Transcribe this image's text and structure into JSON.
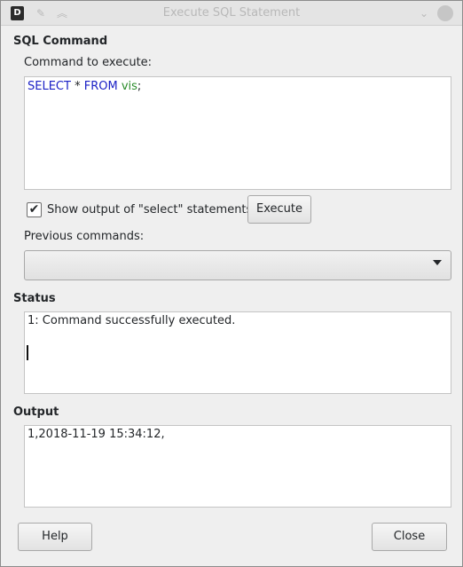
{
  "window": {
    "title": "Execute SQL Statement",
    "app_icon": "D"
  },
  "sql_command": {
    "section_title": "SQL Command",
    "command_label": "Command to execute:",
    "sql": {
      "kw1": "SELECT",
      "op": " * ",
      "kw2": "FROM",
      "space": " ",
      "table": "vis",
      "end": ";"
    },
    "show_output_label": "Show output of \"select\" statements",
    "show_output_checked": "✔",
    "execute_label": "Execute",
    "previous_label": "Previous commands:",
    "previous_value": ""
  },
  "status": {
    "section_title": "Status",
    "text": "1: Command successfully executed."
  },
  "output": {
    "section_title": "Output",
    "text": "1,2018-11-19 15:34:12,"
  },
  "footer": {
    "help_label": "Help",
    "close_label": "Close"
  },
  "colors": {
    "keyword": "#1c22c6",
    "identifier": "#2a8c2a"
  }
}
